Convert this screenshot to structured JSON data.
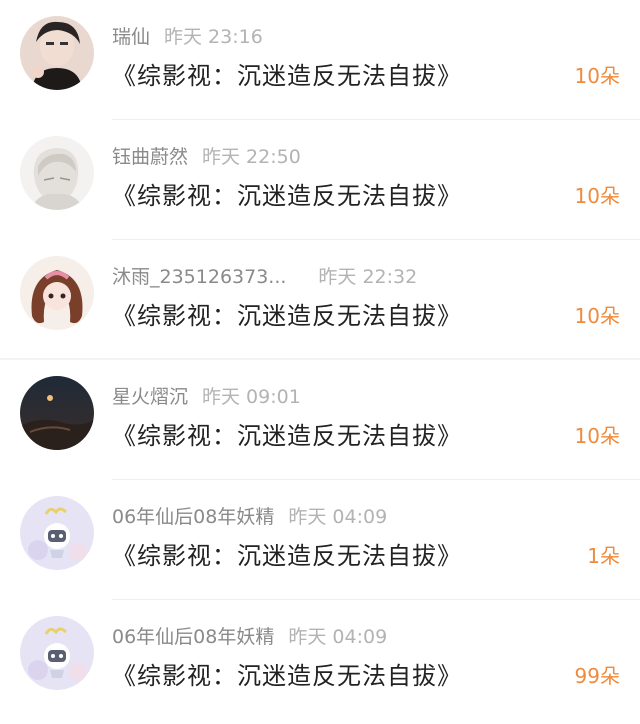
{
  "items": [
    {
      "name": "瑞仙",
      "time": "昨天 23:16",
      "title": "《综影视：沉迷造反无法自拔》",
      "gift": "10朵",
      "avatar": "avatar-icon"
    },
    {
      "name": "钰曲蔚然",
      "time": "昨天 22:50",
      "title": "《综影视：沉迷造反无法自拔》",
      "gift": "10朵",
      "avatar": "avatar-icon"
    },
    {
      "name": "沐雨_235126373...",
      "time": "昨天 22:32",
      "title": "《综影视：沉迷造反无法自拔》",
      "gift": "10朵",
      "avatar": "avatar-icon"
    },
    {
      "name": "星火熠沉",
      "time": "昨天 09:01",
      "title": "《综影视：沉迷造反无法自拔》",
      "gift": "10朵",
      "avatar": "avatar-icon"
    },
    {
      "name": "06年仙后08年妖精",
      "time": "昨天 04:09",
      "title": "《综影视：沉迷造反无法自拔》",
      "gift": "1朵",
      "avatar": "avatar-icon"
    },
    {
      "name": "06年仙后08年妖精",
      "time": "昨天 04:09",
      "title": "《综影视：沉迷造反无法自拔》",
      "gift": "99朵",
      "avatar": "avatar-icon"
    }
  ],
  "colors": {
    "gift": "#f08a3c",
    "name": "#8a8a8a",
    "time": "#b3b3b3",
    "title": "#222222"
  }
}
